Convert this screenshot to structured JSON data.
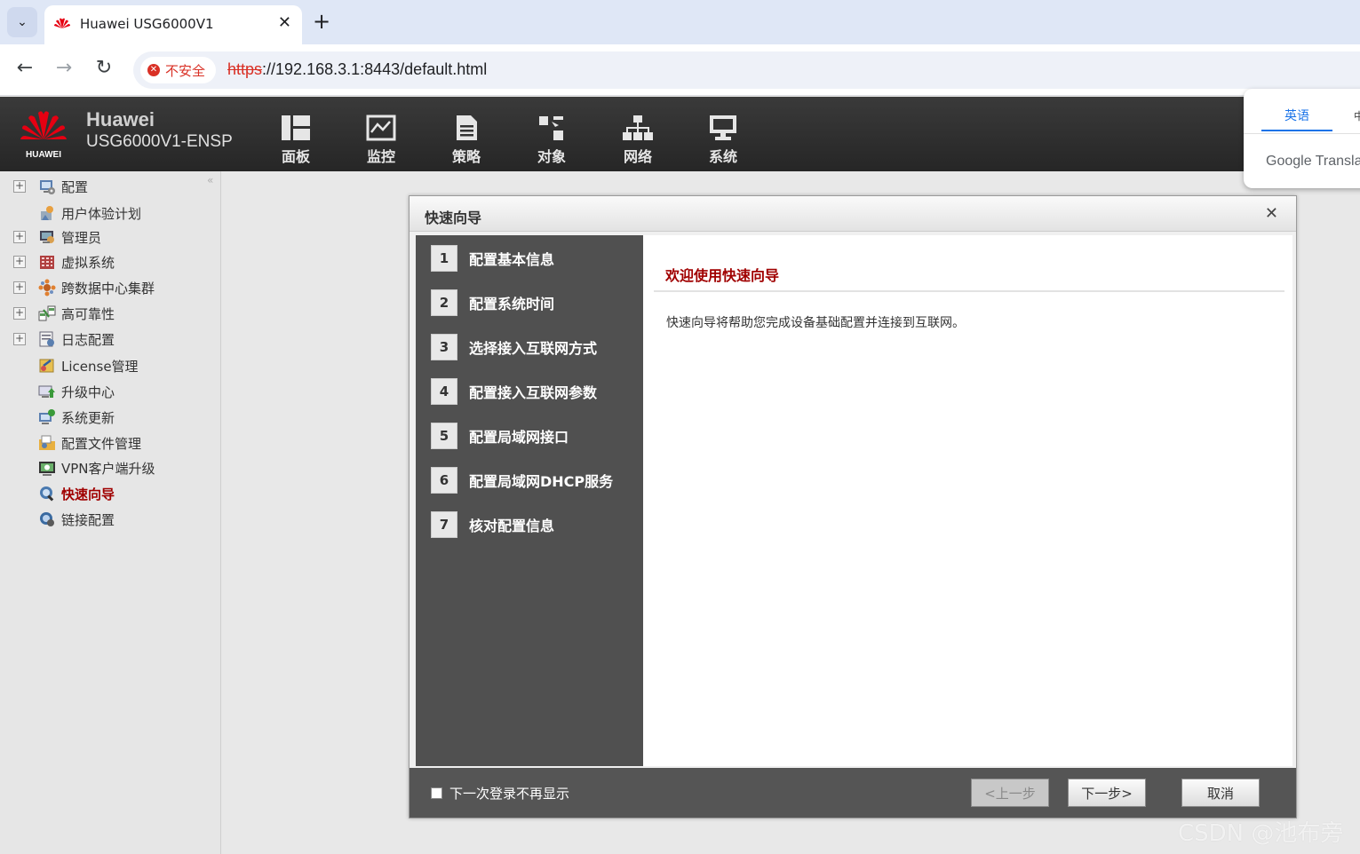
{
  "browser": {
    "tab_title": "Huawei USG6000V1",
    "security_label": "不安全",
    "url_protocol": "https",
    "url_rest": "://192.168.3.1:8443/default.html"
  },
  "translate": {
    "lang_active": "英语",
    "lang_other": "中",
    "brand": "Google Translate"
  },
  "header": {
    "brand_line1": "Huawei",
    "brand_line2": "USG6000V1-ENSP",
    "logo_text": "HUAWEI",
    "nav": [
      {
        "label": "面板",
        "icon": "dashboard-icon"
      },
      {
        "label": "监控",
        "icon": "monitor-icon"
      },
      {
        "label": "策略",
        "icon": "policy-icon"
      },
      {
        "label": "对象",
        "icon": "object-icon"
      },
      {
        "label": "网络",
        "icon": "network-icon"
      },
      {
        "label": "系统",
        "icon": "system-icon"
      }
    ]
  },
  "sidebar": {
    "items": [
      {
        "label": "配置",
        "expandable": true
      },
      {
        "label": "用户体验计划",
        "expandable": false
      },
      {
        "label": "管理员",
        "expandable": true
      },
      {
        "label": "虚拟系统",
        "expandable": true
      },
      {
        "label": "跨数据中心集群",
        "expandable": true
      },
      {
        "label": "高可靠性",
        "expandable": true
      },
      {
        "label": "日志配置",
        "expandable": true
      },
      {
        "label": "License管理",
        "expandable": false
      },
      {
        "label": "升级中心",
        "expandable": false
      },
      {
        "label": "系统更新",
        "expandable": false
      },
      {
        "label": "配置文件管理",
        "expandable": false
      },
      {
        "label": "VPN客户端升级",
        "expandable": false
      },
      {
        "label": "快速向导",
        "expandable": false,
        "active": true
      },
      {
        "label": "链接配置",
        "expandable": false
      }
    ]
  },
  "dialog": {
    "title": "快速向导",
    "steps": [
      {
        "num": "1",
        "label": "配置基本信息"
      },
      {
        "num": "2",
        "label": "配置系统时间"
      },
      {
        "num": "3",
        "label": "选择接入互联网方式"
      },
      {
        "num": "4",
        "label": "配置接入互联网参数"
      },
      {
        "num": "5",
        "label": "配置局域网接口"
      },
      {
        "num": "6",
        "label": "配置局域网DHCP服务"
      },
      {
        "num": "7",
        "label": "核对配置信息"
      }
    ],
    "welcome_title": "欢迎使用快速向导",
    "welcome_desc": "快速向导将帮助您完成设备基础配置并连接到互联网。",
    "checkbox_label": "下一次登录不再显示",
    "prev_label": "<上一步",
    "next_label": "下一步>",
    "cancel_label": "取消"
  },
  "watermark": "CSDN @池布旁",
  "colors": {
    "accent_red": "#a00000",
    "header_bg": "#2e2e2e",
    "steps_bg": "#505050"
  }
}
